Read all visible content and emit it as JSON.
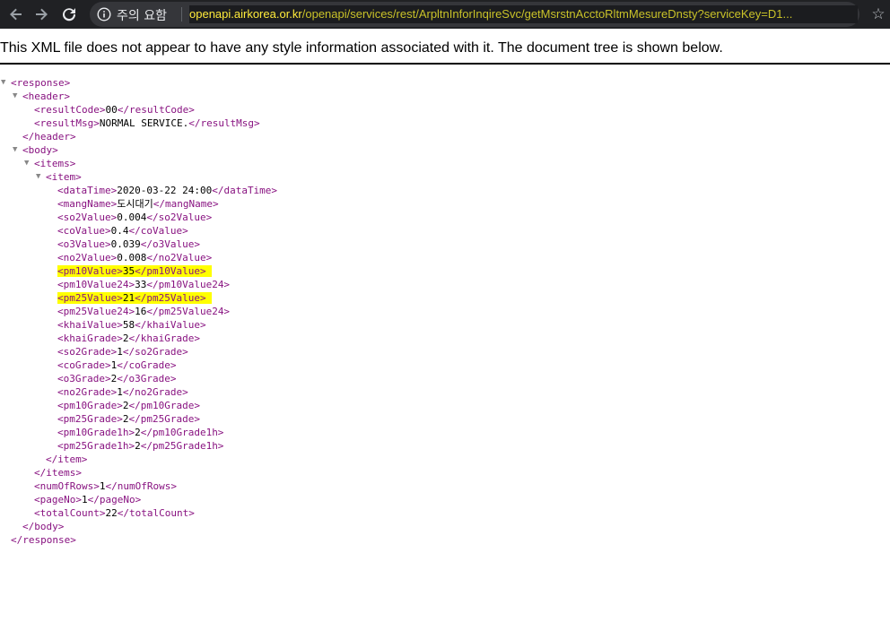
{
  "browser": {
    "security_label": "주의 요함",
    "url_host": "openapi.airkorea.or.kr",
    "url_path": "/openapi/services/rest/ArpltnInforInqireSvc/getMsrstnAcctoRltmMesureDnsty?serviceKey=D1...",
    "icons": [
      "arrow-left-icon",
      "arrow-right-icon",
      "reload-icon",
      "info-icon",
      "star-icon"
    ]
  },
  "notice": "This XML file does not appear to have any style information associated with it. The document tree is shown below.",
  "xml": {
    "response": "response",
    "header": "header",
    "body": "body",
    "items": "items",
    "item": "item",
    "resultCode": {
      "tag": "resultCode",
      "value": "00"
    },
    "resultMsg": {
      "tag": "resultMsg",
      "value": "NORMAL SERVICE."
    },
    "fields": [
      {
        "tag": "dataTime",
        "value": "2020-03-22 24:00"
      },
      {
        "tag": "mangName",
        "value": "도시대기"
      },
      {
        "tag": "so2Value",
        "value": "0.004"
      },
      {
        "tag": "coValue",
        "value": "0.4"
      },
      {
        "tag": "o3Value",
        "value": "0.039"
      },
      {
        "tag": "no2Value",
        "value": "0.008"
      },
      {
        "tag": "pm10Value",
        "value": "35"
      },
      {
        "tag": "pm10Value24",
        "value": "33"
      },
      {
        "tag": "pm25Value",
        "value": "21"
      },
      {
        "tag": "pm25Value24",
        "value": "16"
      },
      {
        "tag": "khaiValue",
        "value": "58"
      },
      {
        "tag": "khaiGrade",
        "value": "2"
      },
      {
        "tag": "so2Grade",
        "value": "1"
      },
      {
        "tag": "coGrade",
        "value": "1"
      },
      {
        "tag": "o3Grade",
        "value": "2"
      },
      {
        "tag": "no2Grade",
        "value": "1"
      },
      {
        "tag": "pm10Grade",
        "value": "2"
      },
      {
        "tag": "pm25Grade",
        "value": "2"
      },
      {
        "tag": "pm10Grade1h",
        "value": "2"
      },
      {
        "tag": "pm25Grade1h",
        "value": "2"
      }
    ],
    "numOfRows": {
      "tag": "numOfRows",
      "value": "1"
    },
    "pageNo": {
      "tag": "pageNo",
      "value": "1"
    },
    "totalCount": {
      "tag": "totalCount",
      "value": "22"
    }
  },
  "colors": {
    "tag": "#881280",
    "highlight": "#ffff00",
    "toolbar": "#202124",
    "url_host": "#ffeb3b"
  }
}
